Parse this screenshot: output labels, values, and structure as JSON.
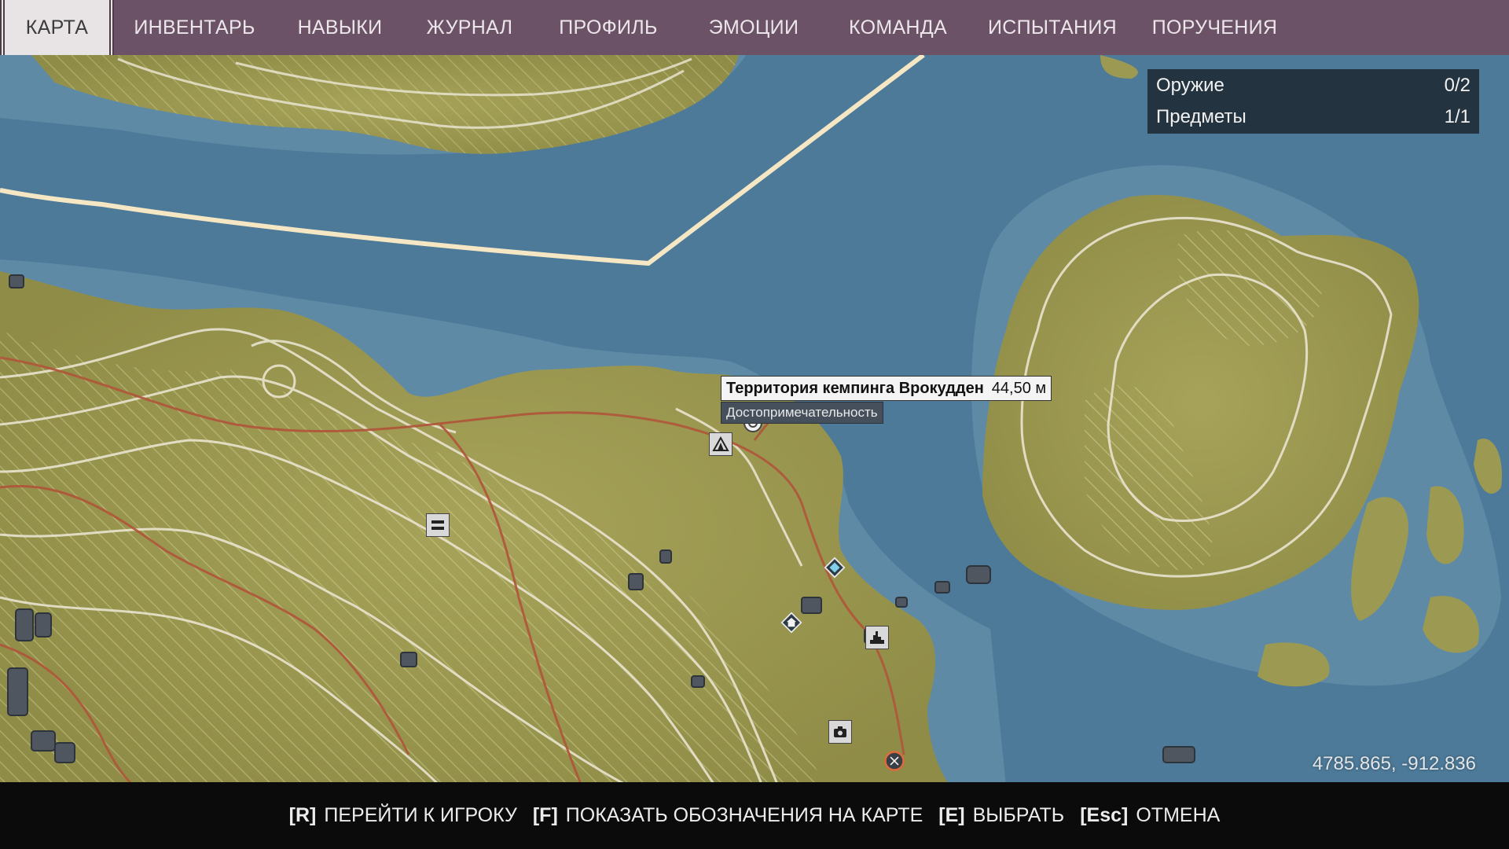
{
  "nav": {
    "tabs": [
      {
        "label": "КАРТА"
      },
      {
        "label": "ИНВЕНТАРЬ"
      },
      {
        "label": "НАВЫКИ"
      },
      {
        "label": "ЖУРНАЛ"
      },
      {
        "label": "ПРОФИЛЬ"
      },
      {
        "label": "ЭМОЦИИ"
      },
      {
        "label": "КОМАНДА"
      },
      {
        "label": "ИСПЫТАНИЯ"
      },
      {
        "label": "ПОРУЧЕНИЯ"
      }
    ],
    "active_tab": "КАРТА"
  },
  "counters": {
    "weapons": {
      "label": "Оружие",
      "value": "0/2"
    },
    "items": {
      "label": "Предметы",
      "value": "1/1"
    }
  },
  "tooltip": {
    "title": "Территория кемпинга Врокудден",
    "distance": "44,50 м",
    "category": "Достопримечательность"
  },
  "coordinates": "4785.865, -912.836",
  "hints": [
    {
      "key": "[R]",
      "label": "ПЕРЕЙТИ К ИГРОКУ"
    },
    {
      "key": "[F]",
      "label": "ПОКАЗАТЬ ОБОЗНАЧЕНИЯ НА КАРТЕ"
    },
    {
      "key": "[E]",
      "label": "ВЫБРАТЬ"
    },
    {
      "key": "[Esc]",
      "label": "ОТМЕНА"
    }
  ],
  "markers": [
    {
      "name": "campsite-icon"
    },
    {
      "name": "waypoint-target-icon"
    },
    {
      "name": "shelter-icon"
    },
    {
      "name": "diamond-objective-icon"
    },
    {
      "name": "house-icon"
    },
    {
      "name": "landmark-icon"
    },
    {
      "name": "camera-icon"
    },
    {
      "name": "player-position-icon"
    }
  ],
  "colors": {
    "water": "#4d7a99",
    "shallow_water": "#5f8aa6",
    "land": "#9c9a52",
    "contour": "#e9e4cf",
    "road": "#b0553a",
    "border_line": "#f6e7c4",
    "nav_bg": "#6b5266",
    "player_marker": "#e06a3c"
  }
}
